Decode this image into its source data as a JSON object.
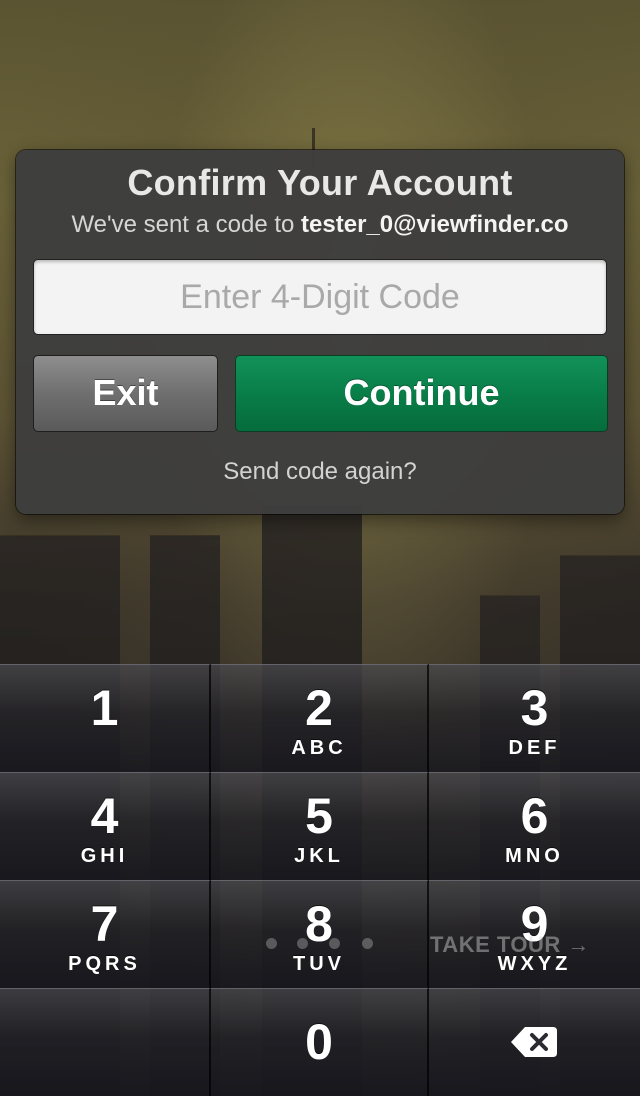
{
  "dialog": {
    "title": "Confirm Your Account",
    "subtitle_prefix": "We've sent a code to ",
    "email": "tester_0@viewfinder.co",
    "code_placeholder": "Enter 4-Digit Code",
    "code_value": "",
    "exit_label": "Exit",
    "continue_label": "Continue",
    "resend_label": "Send code again?"
  },
  "keypad": {
    "keys": [
      {
        "digit": "1",
        "letters": ""
      },
      {
        "digit": "2",
        "letters": "ABC"
      },
      {
        "digit": "3",
        "letters": "DEF"
      },
      {
        "digit": "4",
        "letters": "GHI"
      },
      {
        "digit": "5",
        "letters": "JKL"
      },
      {
        "digit": "6",
        "letters": "MNO"
      },
      {
        "digit": "7",
        "letters": "PQRS"
      },
      {
        "digit": "8",
        "letters": "TUV"
      },
      {
        "digit": "9",
        "letters": "WXYZ"
      },
      {
        "digit": "0",
        "letters": ""
      }
    ],
    "backspace_icon": "backspace-icon"
  },
  "tour": {
    "label": "TAKE TOUR →",
    "page_count": 4
  },
  "colors": {
    "continue": "#087a45",
    "exit": "#6f6f6f",
    "dialog_bg": "#3e3e3e"
  }
}
